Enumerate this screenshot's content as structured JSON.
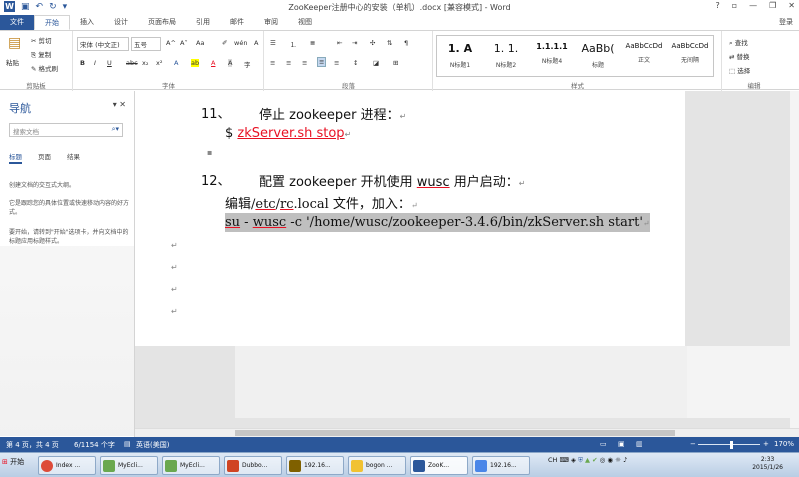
{
  "titlebar": {
    "title": "ZooKeeper注册中心的安装（单机）.docx [兼容模式] - Word",
    "help": "?",
    "ribbon_display": "▫",
    "minimize": "—",
    "restore": "❐",
    "close": "✕",
    "qat": {
      "save_icon": "save-icon",
      "undo_label": "↶",
      "redo_label": "↻",
      "customize_label": "▾"
    }
  },
  "ribbon_tabs": [
    "文件",
    "开始",
    "插入",
    "设计",
    "页面布局",
    "引用",
    "邮件",
    "审阅",
    "视图"
  ],
  "login": "登录",
  "ribbon": {
    "clipboard": {
      "paste": "粘贴",
      "cut": "剪切",
      "copy": "复制",
      "format_painter": "格式刷",
      "label": "剪贴板"
    },
    "font": {
      "font_name": "宋体 (中文正)",
      "font_size": "五号",
      "bold": "B",
      "italic": "I",
      "underline": "U",
      "strike": "abc",
      "sub": "x₂",
      "sup": "x²",
      "grow": "A^",
      "shrink": "A˅",
      "case": "Aa",
      "clear": "✐",
      "pinyin": "wén",
      "border_char": "A",
      "effects": "A",
      "highlight": "ab",
      "font_color": "A",
      "shading": "A",
      "enclosed": "字",
      "label": "字体"
    },
    "paragraph": {
      "label": "段落",
      "show_marks": "¶"
    },
    "styles": {
      "items": [
        {
          "preview": "1. A",
          "name": "N标题1"
        },
        {
          "preview": "1. 1.",
          "name": "N标题2"
        },
        {
          "preview": "1.1.1.1",
          "name": "N标题4"
        },
        {
          "preview": "AaBb(",
          "name": "标题"
        },
        {
          "preview": "AaBbCcDd",
          "name": "正文"
        },
        {
          "preview": "AaBbCcDd",
          "name": "无间隔"
        }
      ],
      "label": "样式"
    },
    "editing": {
      "find": "查找",
      "replace": "替换",
      "select": "选择",
      "label": "编辑"
    }
  },
  "navigation": {
    "title": "导航",
    "search_placeholder": "搜索文档",
    "tabs": [
      "标题",
      "页面",
      "结果"
    ],
    "hints": [
      "创建文档的交互式大纲。",
      "它是跟踪您的具体位置或快速移动内容的好方式。",
      "要开始，请转到\"开始\"选项卡，并向文档中的标题应用标题样式。"
    ]
  },
  "document": {
    "step11": {
      "num": "11、",
      "text": "停止 zookeeper 进程：",
      "cmd_prefix": "$ ",
      "cmd": "zkServer.sh stop"
    },
    "step12": {
      "num": "12、",
      "text_a": "配置 zookeeper 开机使用 ",
      "text_user": "wusc",
      "text_b": " 用户启动：",
      "edit_a": "编辑/",
      "edit_etc": "etc",
      "edit_sep": "/",
      "edit_rc": "rc",
      "edit_b": ".local 文件，加入：",
      "cmd_su": "su",
      "cmd_dash": " - ",
      "cmd_user": "wusc",
      "cmd_rest": " -c '/home/wusc/zookeeper-3.4.6/bin/zkServer.sh start'"
    },
    "para_mark": "↵"
  },
  "statusbar": {
    "page": "第 4 页，共 4 页",
    "words": "6/1154 个字",
    "language": "英语(美国)",
    "zoom": "170%"
  },
  "taskbar": {
    "start": "开始",
    "buttons": [
      {
        "label": "Index ...",
        "color": "#dd4b39"
      },
      {
        "label": "MyEcli...",
        "color": "#6aa84f"
      },
      {
        "label": "MyEcli...",
        "color": "#6aa84f"
      },
      {
        "label": "Dubbo...",
        "color": "#d04423"
      },
      {
        "label": "192.16...",
        "color": "#7f6000"
      },
      {
        "label": "bogon ...",
        "color": "#f1c232"
      },
      {
        "label": "ZooK...",
        "color": "#2b579a"
      },
      {
        "label": "192.16...",
        "color": "#4a86e8"
      }
    ],
    "ime": "CH",
    "time": "2:33",
    "date": "2015/1/26"
  }
}
